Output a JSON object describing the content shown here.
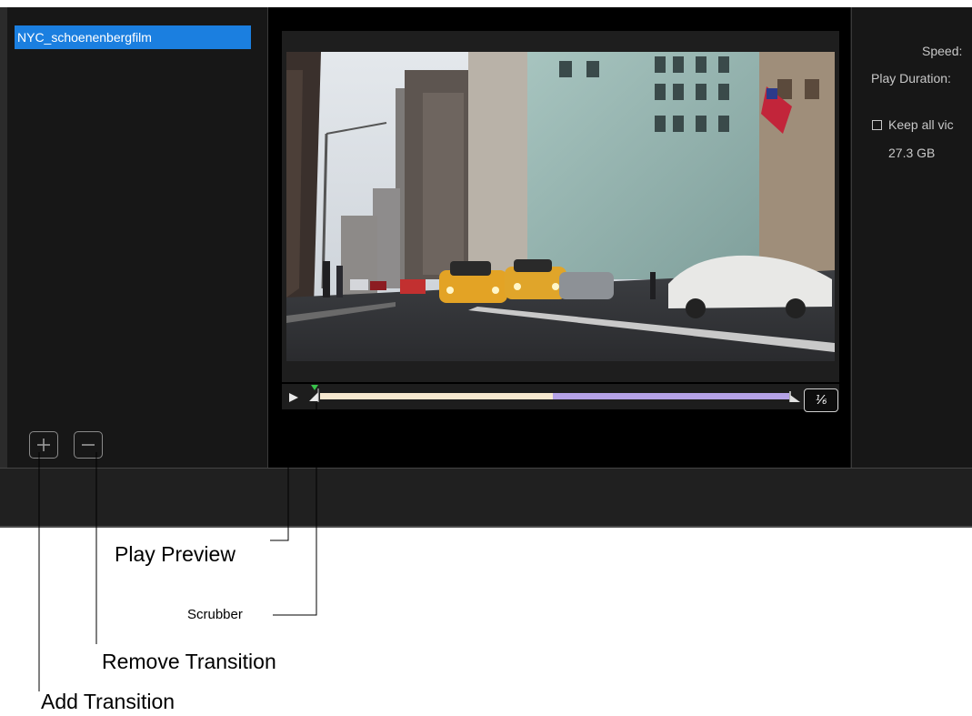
{
  "clip_list": {
    "items": [
      {
        "label": "NYC_schoenenbergfilm",
        "selected": true
      }
    ]
  },
  "buttons": {
    "add_icon": "plus-icon",
    "remove_icon": "minus-icon"
  },
  "preview": {
    "play_icon": "play-icon",
    "ratio_label": "⅙"
  },
  "settings": {
    "speed_label": "Speed:",
    "play_duration_label": "Play Duration:",
    "keep_label": "Keep all vic",
    "storage_size": "27.3 GB"
  },
  "annotations": {
    "play_preview": "Play Preview",
    "scrubber": "Scrubber",
    "remove_transition": "Remove Transition",
    "add_transition": "Add Transition"
  },
  "colors": {
    "selection": "#1b7fe0",
    "track_first": "#f5e7cf",
    "track_second": "#b5a2e6",
    "scrubber_head": "#38c24a"
  }
}
